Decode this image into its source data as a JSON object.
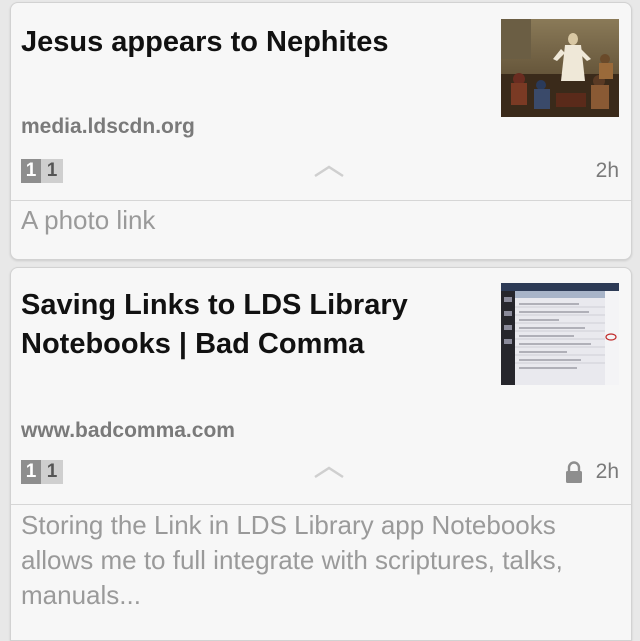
{
  "feed": {
    "items": [
      {
        "title": "Jesus appears to Nephites",
        "domain": "media.ldscdn.org",
        "votes_left": "1",
        "votes_right": "1",
        "time": "2h",
        "description": "A photo link",
        "thumbnail_icon": "painting-thumbnail",
        "locked": false
      },
      {
        "title": "Saving Links to LDS Library Notebooks | Bad Comma",
        "domain": "www.badcomma.com",
        "votes_left": "1",
        "votes_right": "1",
        "time": "2h",
        "description": "Storing the Link in LDS Library app Notebooks allows me to full integrate with scriptures, talks, manuals...",
        "thumbnail_icon": "app-screenshot-thumbnail",
        "locked": true
      }
    ]
  },
  "colors": {
    "card_bg": "#f7f7f7",
    "title": "#111111",
    "secondary_text": "#7a7a7a",
    "vote_dark": "#8e8e8e",
    "vote_light": "#cfcfcf"
  }
}
